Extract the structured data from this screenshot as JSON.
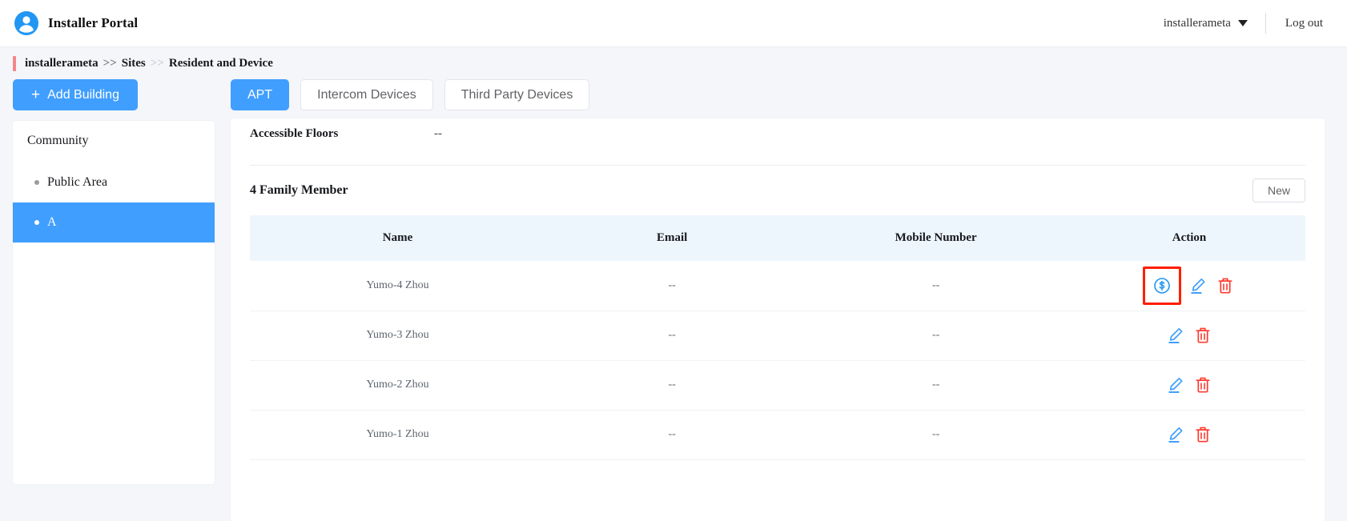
{
  "header": {
    "avatar_icon": "user-avatar-icon",
    "title": "Installer Portal",
    "account_name": "installerameta",
    "caret_icon": "chevron-down-icon",
    "logout_label": "Log out"
  },
  "breadcrumb": {
    "items": [
      "installerameta",
      "Sites",
      "Resident and Device"
    ],
    "separator": ">>"
  },
  "sidebar": {
    "add_building_label": "Add Building",
    "add_building_icon": "plus-icon",
    "root_label": "Community",
    "items": [
      {
        "label": "Public Area",
        "selected": false
      },
      {
        "label": "A",
        "selected": true
      }
    ]
  },
  "tabs": [
    {
      "label": "APT",
      "active": true
    },
    {
      "label": "Intercom Devices",
      "active": false
    },
    {
      "label": "Third Party Devices",
      "active": false
    }
  ],
  "detail": {
    "accessible_floors_label": "Accessible Floors",
    "accessible_floors_value": "--"
  },
  "family": {
    "section_title": "4 Family Member",
    "new_label": "New",
    "columns": [
      "Name",
      "Email",
      "Mobile Number",
      "Action"
    ],
    "rows": [
      {
        "name": "Yumo-4 Zhou",
        "email": "--",
        "mobile": "--",
        "actions": [
          "payment-icon",
          "edit-icon",
          "delete-icon"
        ],
        "highlighted_action": "payment-icon"
      },
      {
        "name": "Yumo-3 Zhou",
        "email": "--",
        "mobile": "--",
        "actions": [
          "edit-icon",
          "delete-icon"
        ],
        "highlighted_action": ""
      },
      {
        "name": "Yumo-2 Zhou",
        "email": "--",
        "mobile": "--",
        "actions": [
          "edit-icon",
          "delete-icon"
        ],
        "highlighted_action": ""
      },
      {
        "name": "Yumo-1 Zhou",
        "email": "--",
        "mobile": "--",
        "actions": [
          "edit-icon",
          "delete-icon"
        ],
        "highlighted_action": ""
      }
    ]
  },
  "colors": {
    "accent_blue": "#409eff",
    "icon_blue": "#2196f3",
    "danger_red": "#ff3b30",
    "highlight_red": "#ff1e00",
    "table_header_bg": "#eef6fd",
    "page_bg": "#f4f6f9",
    "crumb_accent": "#f4868a"
  }
}
